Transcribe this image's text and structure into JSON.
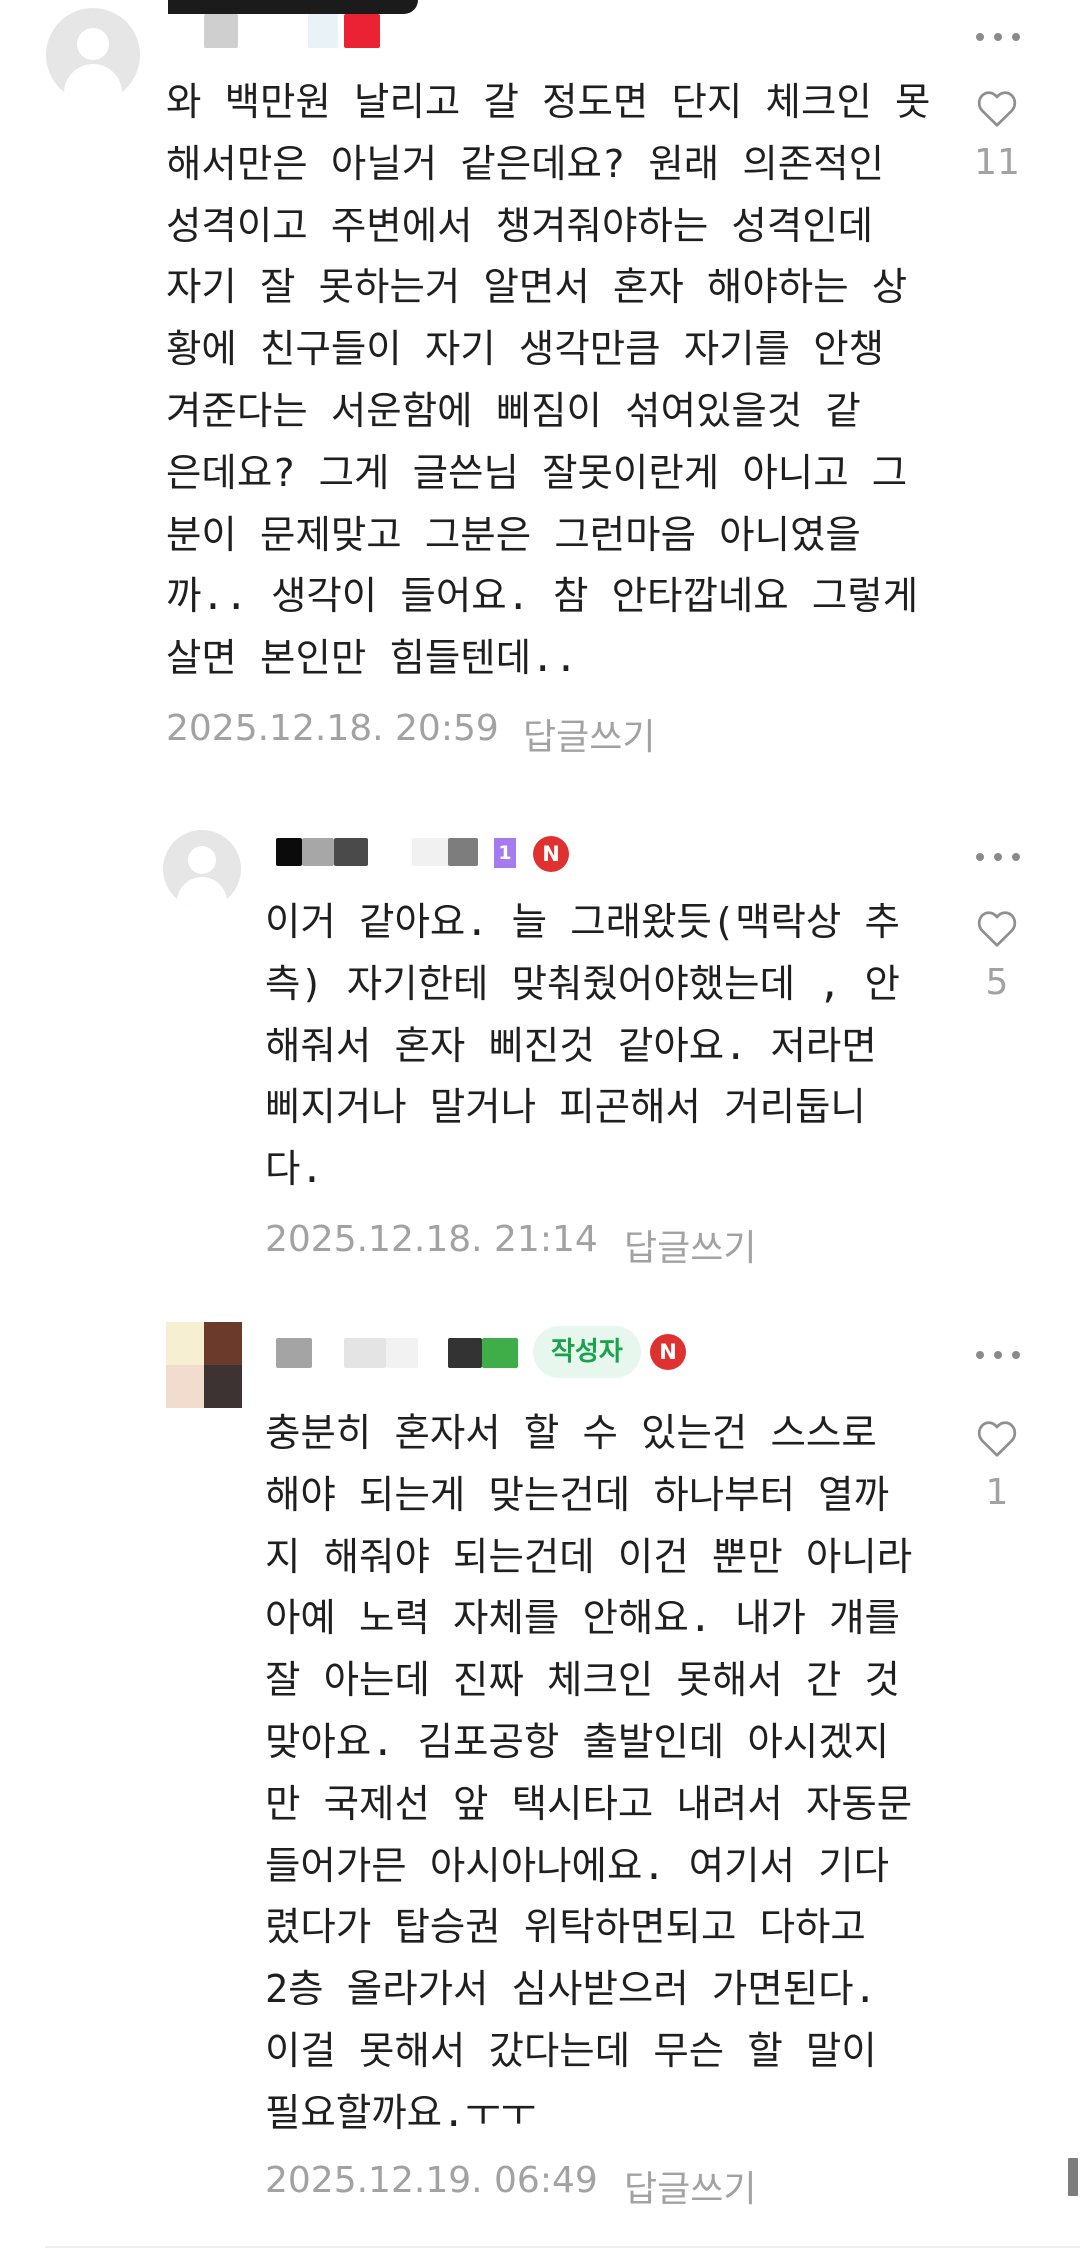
{
  "comments": [
    {
      "text": "와 백만원 날리고 갈 정도면 단지 체크인 못\n해서만은 아닐거 같은데요? 원래 의존적인\n성격이고 주변에서 챙겨줘야하는 성격인데\n자기 잘 못하는거 알면서 혼자 해야하는 상\n황에 친구들이 자기 생각만큼 자기를 안챙\n겨준다는 서운함에 삐짐이 섞여있을것 같\n은데요? 그게 글쓴님 잘못이란게 아니고 그\n분이 문제맞고 그분은 그런마음 아니였을\n까.. 생각이 들어요. 참 안타깝네요 그렇게\n살면 본인만 힘들텐데..",
      "date": "2025.12.18. 20:59",
      "reply_label": "답글쓰기",
      "likes": "11"
    },
    {
      "text": "이거 같아요. 늘 그래왔듯(맥락상 추\n측) 자기한테 맞춰줬어야했는데 , 안\n해줘서 혼자 삐진것 같아요. 저라면\n삐지거나 말거나 피곤해서 거리둡니\n다.",
      "date": "2025.12.18. 21:14",
      "reply_label": "답글쓰기",
      "likes": "5",
      "level_badge": "1",
      "n_badge": "N"
    },
    {
      "text": "충분히 혼자서 할 수 있는건 스스로\n해야 되는게 맞는건데 하나부터 열까\n지 해줘야 되는건데 이건 뿐만 아니라\n아예 노력 자체를 안해요. 내가 걔를\n잘 아는데 진짜 체크인 못해서 간 것\n맞아요. 김포공항 출발인데 아시겠지\n만 국제선 앞 택시타고 내려서 자동문\n들어가믄 아시아나에요. 여기서 기다\n렸다가 탑승권 위탁하면되고 다하고\n2층 올라가서 심사받으러 가면된다.\n이걸 못해서 갔다는데 무슨 할 말이\n필요할까요.ㅜㅜ",
      "date": "2025.12.19. 06:49",
      "reply_label": "답글쓰기",
      "likes": "1",
      "author_badge": "작성자",
      "n_badge": "N"
    }
  ],
  "icons": {
    "more": "more-vertical-dots-icon",
    "like": "heart-outline-icon",
    "avatar": "default-profile-icon"
  },
  "colors": {
    "accent_green": "#16a34a",
    "author_badge_bg": "#e8f7ee",
    "n_badge": "#e03131",
    "level_badge": "#a67bf0",
    "meta_gray": "#a2a2a2"
  }
}
